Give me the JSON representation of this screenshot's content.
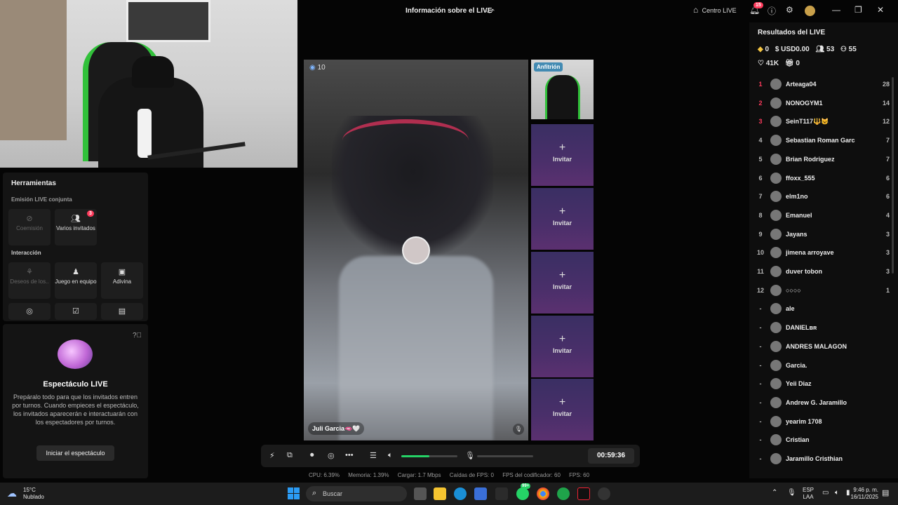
{
  "window": {
    "title": "Información sobre el LIVE",
    "centro_live": "Centro LIVE",
    "notif_count": "15"
  },
  "tools": {
    "title": "Herramientas",
    "co_host_section": "Emisión LIVE conjunta",
    "coemision": "Coemisión",
    "varios_invitados": "Varios invitados",
    "varios_badge": "3",
    "interaction_section": "Interacción",
    "deseos": "Deseos de los..",
    "juego_equipo": "Juego en equipo",
    "adivina": "Adivina"
  },
  "show": {
    "title": "Espectáculo LIVE",
    "description": "Prepáralo todo para que los invitados entren por turnos. Cuando empieces el espectáculo, los invitados aparecerán e interactuarán con los espectadores por turnos.",
    "button": "Iniciar el espectáculo"
  },
  "video": {
    "viewer_count": "10",
    "guest_name": "Juli Garcia🫦🤍",
    "host_tag": "Anfitrión",
    "invite_label": "Invitar"
  },
  "controls": {
    "timer": "00:59:36",
    "volume_level": 0.5
  },
  "stats": {
    "cpu": "CPU: 6.39%",
    "memoria": "Memoria: 1.39%",
    "cargar": "Cargar: 1.7 Mbps",
    "caidas": "Caídas de FPS: 0",
    "fps_codificador": "FPS del codificador: 60",
    "fps": "FPS: 60"
  },
  "results": {
    "title": "Resultados del LIVE",
    "diamonds": "0",
    "usd": "USD0.00",
    "viewers": "53",
    "new_followers": "55",
    "likes": "41K",
    "gifts": "0",
    "ranking": [
      {
        "rank": "1",
        "name": "Arteaga04",
        "score": "28",
        "color": "#ff3b5c"
      },
      {
        "rank": "2",
        "name": "NONOGYM1",
        "score": "14",
        "color": "#ff3b5c"
      },
      {
        "rank": "3",
        "name": "SeinT117🔱😺",
        "score": "12",
        "color": "#ff3b5c"
      },
      {
        "rank": "4",
        "name": "Sebastian Roman Garc",
        "score": "7",
        "color": "#bbbbbb"
      },
      {
        "rank": "5",
        "name": "Brian Rodriguez",
        "score": "7",
        "color": "#bbbbbb"
      },
      {
        "rank": "6",
        "name": "ffoxx_555",
        "score": "6",
        "color": "#bbbbbb"
      },
      {
        "rank": "7",
        "name": "elm1no",
        "score": "6",
        "color": "#bbbbbb"
      },
      {
        "rank": "8",
        "name": "Emanuel",
        "score": "4",
        "color": "#bbbbbb"
      },
      {
        "rank": "9",
        "name": "Jayans",
        "score": "3",
        "color": "#bbbbbb"
      },
      {
        "rank": "10",
        "name": "jimena arroyave",
        "score": "3",
        "color": "#bbbbbb"
      },
      {
        "rank": "11",
        "name": "duver tobon",
        "score": "3",
        "color": "#bbbbbb"
      },
      {
        "rank": "12",
        "name": "○○○○",
        "score": "1",
        "color": "#bbbbbb"
      },
      {
        "rank": "-",
        "name": "ale",
        "score": "",
        "color": "#bbbbbb"
      },
      {
        "rank": "-",
        "name": "DANIELʙʀ",
        "score": "",
        "color": "#bbbbbb"
      },
      {
        "rank": "-",
        "name": "ANDRES MALAGON",
        "score": "",
        "color": "#bbbbbb"
      },
      {
        "rank": "-",
        "name": "Garcia.",
        "score": "",
        "color": "#bbbbbb"
      },
      {
        "rank": "-",
        "name": "Yeii Diaz",
        "score": "",
        "color": "#bbbbbb"
      },
      {
        "rank": "-",
        "name": "Andrew G. Jaramillo",
        "score": "",
        "color": "#bbbbbb"
      },
      {
        "rank": "-",
        "name": "yearim 1708",
        "score": "",
        "color": "#bbbbbb"
      },
      {
        "rank": "-",
        "name": "Cristian",
        "score": "",
        "color": "#bbbbbb"
      },
      {
        "rank": "-",
        "name": "Jaramillo Cristhian",
        "score": "",
        "color": "#bbbbbb"
      }
    ]
  },
  "taskbar": {
    "temp": "15°C",
    "weather": "Nublado",
    "search_placeholder": "Buscar",
    "whatsapp_badge": "99+",
    "lang": "ESP",
    "region": "LAA",
    "time": "9:46 p. m.",
    "date": "16/11/2025"
  },
  "colors": {
    "accent": "#ff3b5c",
    "volume": "#25d366"
  }
}
